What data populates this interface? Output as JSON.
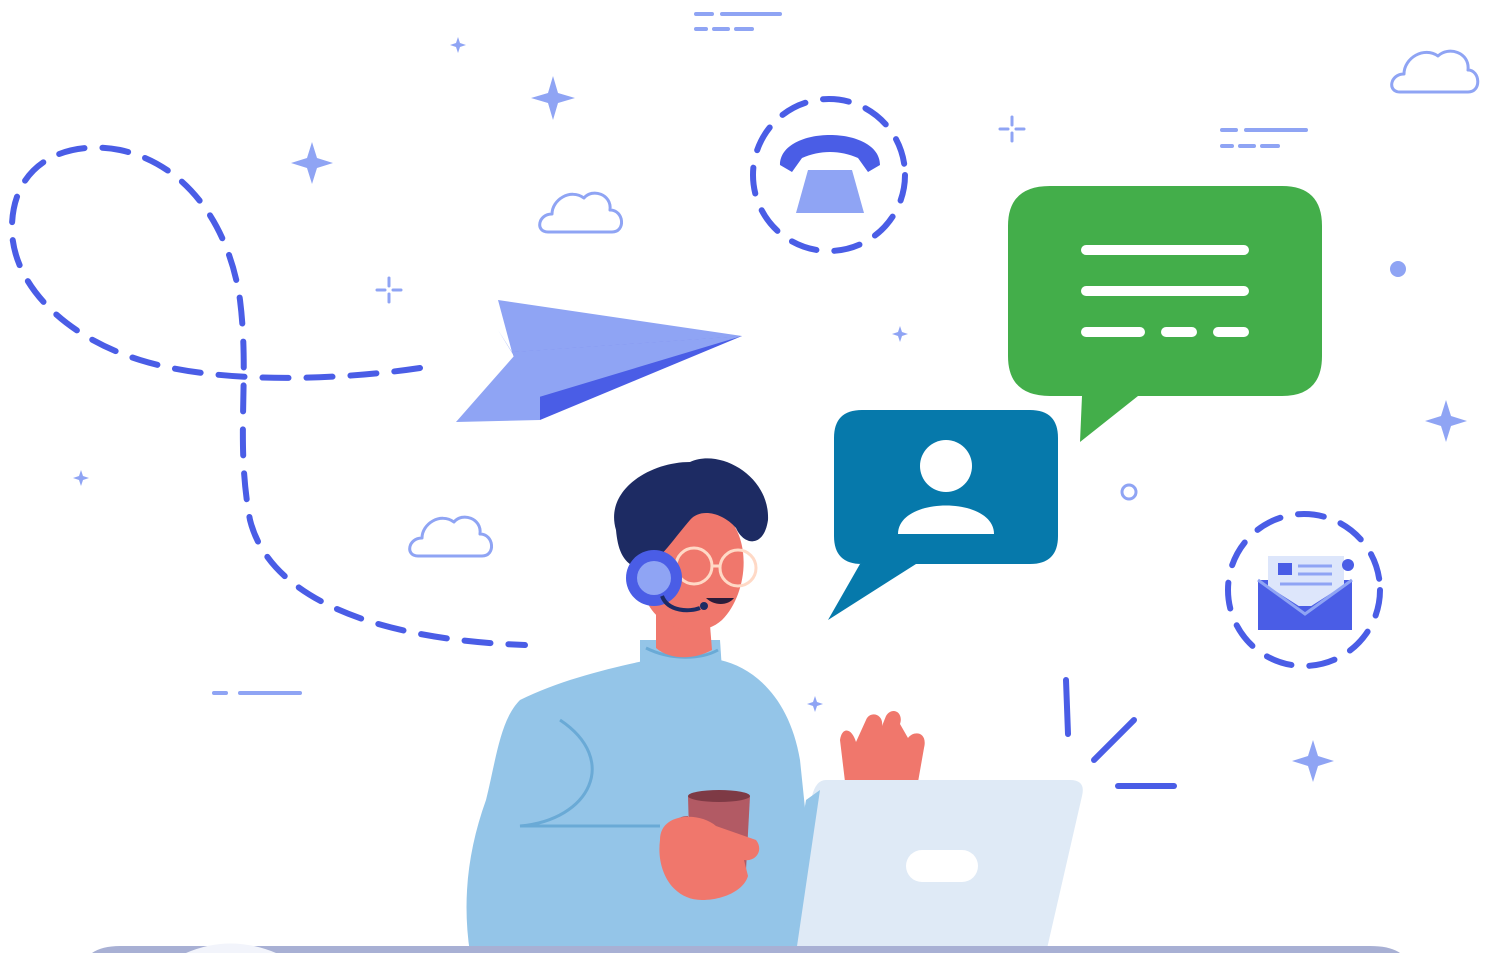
{
  "illustration": {
    "subject": "customer-support-agent",
    "icons": [
      "telephone-icon",
      "paper-plane-icon",
      "chat-bubble-icon",
      "user-profile-icon",
      "envelope-icon",
      "cloud-icon",
      "sparkle-icon"
    ],
    "colors": {
      "accent_blue": "#4a5de6",
      "light_blue": "#8fa4f4",
      "green_bubble": "#43ae4a",
      "teal_bubble": "#0679ab",
      "shirt": "#94c5e8",
      "hair": "#1d2b63",
      "skin": "#f0776c",
      "laptop": "#dfeaf6",
      "mug": "#b25a64"
    }
  }
}
